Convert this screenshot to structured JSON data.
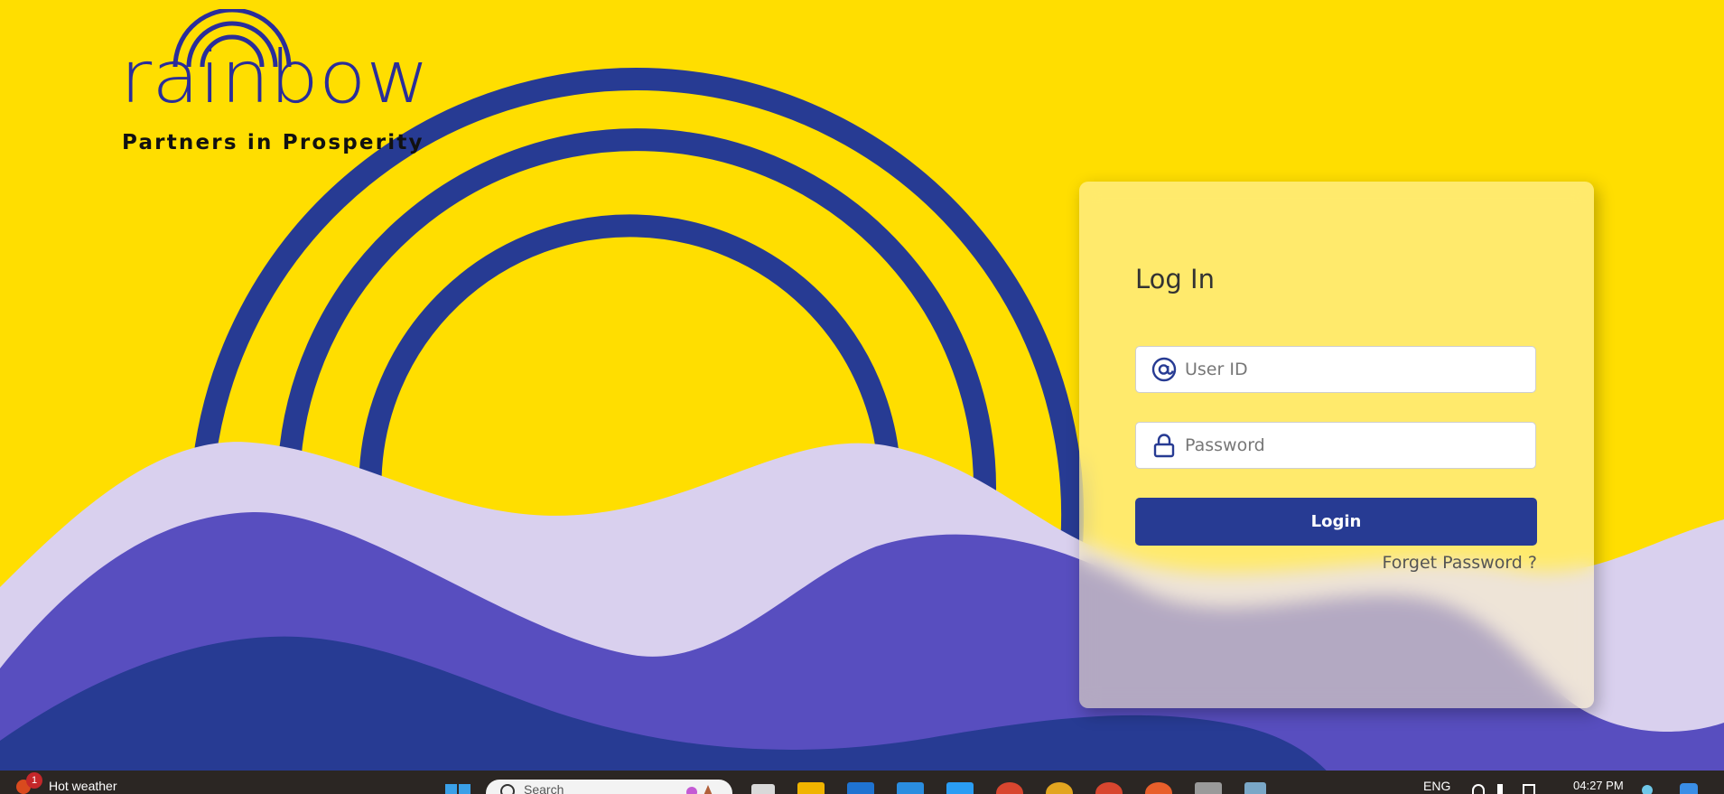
{
  "brand": {
    "name": "rainbow",
    "tagline": "Partners in Prosperity"
  },
  "login": {
    "title": "Log In",
    "user_placeholder": "User ID",
    "password_placeholder": "Password",
    "login_label": "Login",
    "forgot_label": "Forget Password ?"
  },
  "taskbar": {
    "weather_badge": "1",
    "weather_text": "Hot weather",
    "search_text": "Search",
    "language": "ENG",
    "time": "04:27 PM",
    "apps": [
      {
        "name": "task-view-icon",
        "color": "#d9d9d9"
      },
      {
        "name": "file-explorer-icon",
        "color": "#f0b400"
      },
      {
        "name": "mail-icon",
        "color": "#1f73d1"
      },
      {
        "name": "store-icon",
        "color": "#2a8de0"
      },
      {
        "name": "vscode-icon",
        "color": "#2a9df4"
      },
      {
        "name": "chrome-profile-icon",
        "color": "#d8462f"
      },
      {
        "name": "chrome-icon",
        "color": "#e2a520"
      },
      {
        "name": "chrome-s-icon",
        "color": "#d8462f"
      },
      {
        "name": "paint-icon",
        "color": "#e85f2b"
      },
      {
        "name": "terminal-icon",
        "color": "#9a9a9a"
      },
      {
        "name": "calculator-icon",
        "color": "#7aa7c7"
      }
    ]
  },
  "colors": {
    "background": "#FFDE00",
    "rainbow_arc": "#273B93",
    "wave_light": "#D9D0EE",
    "wave_mid": "#584EBF",
    "wave_dark": "#273B93",
    "button": "#273B93"
  }
}
